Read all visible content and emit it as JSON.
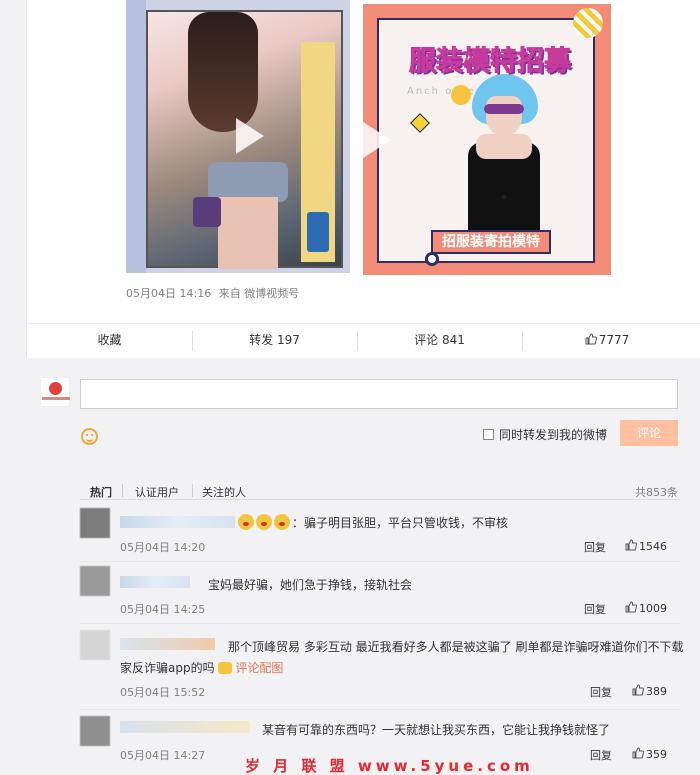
{
  "post": {
    "time": "05月04日 14:16",
    "source": "来自 微博视频号",
    "poster_headline": "服装模特招募",
    "poster_subhead": "Anch order",
    "poster_banner": "招服装寄拍模特"
  },
  "actions": {
    "favorite": "收藏",
    "repost": "转发 197",
    "comment": "评论 841",
    "like": "7777"
  },
  "compose": {
    "placeholder": "",
    "also_repost": "同时转发到我的微博",
    "submit": "评论"
  },
  "comment_tabs": {
    "hot": "热门",
    "verified": "认证用户",
    "following": "关注的人",
    "total": "共853条"
  },
  "comments": [
    {
      "text": "：骗子明目张胆，平台只管收钱，不审核",
      "time": "05月04日 14:20",
      "reply": "回复",
      "likes": "1546"
    },
    {
      "text": "宝妈最好骗，她们急于挣钱，接轨社会",
      "time": "05月04日 14:25",
      "reply": "回复",
      "likes": "1009"
    },
    {
      "text_line1": "那个顶峰贸易 多彩互动 最近我看好多人都是被这骗了 刷单都是诈骗呀难道你们不下载",
      "text_line2": "家反诈骗app的吗",
      "pic_link": "评论配图",
      "time": "05月04日 15:52",
      "reply": "回复",
      "likes": "389"
    },
    {
      "text": "某音有可靠的东西吗？一天就想让我买东西，它能让我挣钱就怪了",
      "time": "05月04日 14:27",
      "reply": "回复",
      "likes": "359"
    }
  ],
  "watermark": "岁 月 联 盟 www.5yue.com",
  "colors": {
    "accent": "#eb7350",
    "submit_bg": "#ffc09f",
    "link": "#eb7350"
  },
  "icons": [
    "thumb-up-icon",
    "emoji-icon",
    "play-icon",
    "picture-icon"
  ]
}
